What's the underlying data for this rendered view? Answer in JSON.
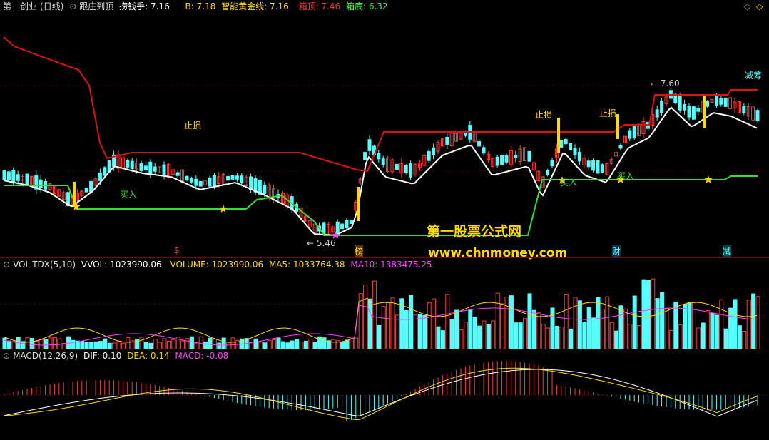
{
  "main": {
    "title": "第一创业",
    "period": "(日线)",
    "indicator_name": "跟庄到顶",
    "labels": [
      {
        "text": "捞钱手: 7.16",
        "color": "#ffffff"
      },
      {
        "text": "B: 7.18",
        "color": "#ffd800"
      },
      {
        "text": "智能黄金线: 7.16",
        "color": "#ffd800"
      },
      {
        "text": "箱顶: 7.46",
        "color": "#ff3030"
      },
      {
        "text": "箱底: 6.32",
        "color": "#33ff33"
      }
    ],
    "annotations": {
      "stop1": "止损",
      "stop2": "止损",
      "stop3": "止损",
      "buy1": "买入",
      "buy2": "买入",
      "buy3": "买入",
      "buy4": "买入",
      "high": "7.60",
      "low": "5.46",
      "reduce": "减筹"
    },
    "markers": {
      "s": "$",
      "bang": "榜",
      "cai": "财",
      "jian": "减"
    }
  },
  "watermark": {
    "line1": "第一股票公式网",
    "line2": "www.chnmoney.com"
  },
  "volume": {
    "name": "VOL-TDX(5,10)",
    "labels": [
      {
        "text": "VVOL: 1023990.06",
        "color": "#ffffff"
      },
      {
        "text": "VOLUME: 1023990.06",
        "color": "#ffd800"
      },
      {
        "text": "MA5: 1033764.38",
        "color": "#ffd800"
      },
      {
        "text": "MA10: 1383475.25",
        "color": "#ff40ff"
      }
    ]
  },
  "macd": {
    "name": "MACD(12,26,9)",
    "labels": [
      {
        "text": "DIF: 0.10",
        "color": "#ffffff"
      },
      {
        "text": "DEA: 0.14",
        "color": "#ffd800"
      },
      {
        "text": "MACD: -0.08",
        "color": "#ff40ff"
      }
    ]
  },
  "controls": {
    "left_icon": "◇",
    "right_icon": "◇"
  },
  "colors": {
    "up": "#ff3b3b",
    "down": "#54ffff",
    "white": "#ffffff",
    "yellow": "#ffd800",
    "magenta": "#ff40ff",
    "green": "#33dd33",
    "red": "#dd1111"
  }
}
